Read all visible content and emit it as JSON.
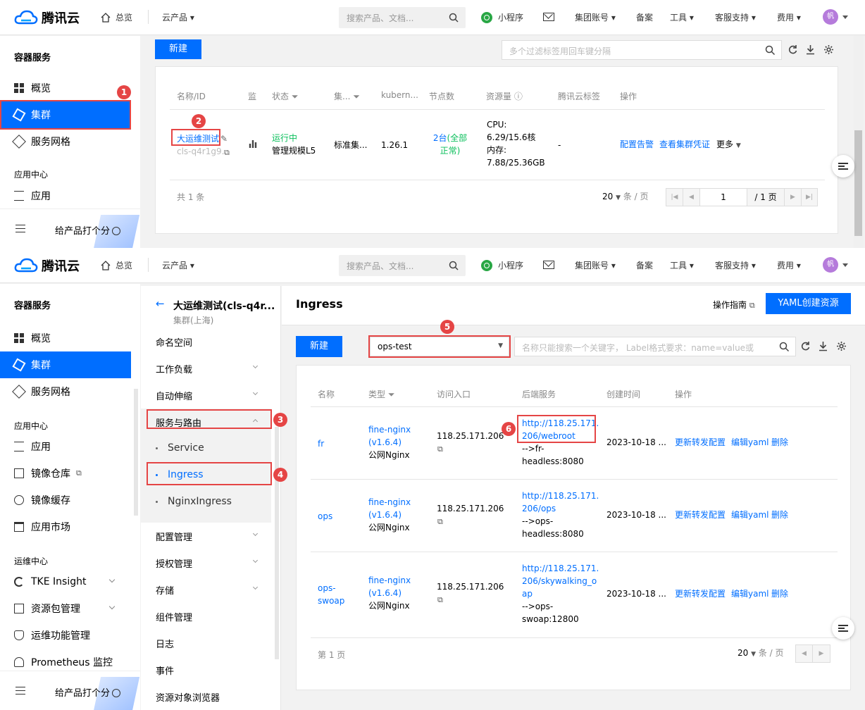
{
  "brand": {
    "name": "腾讯云",
    "accent": "#006eff",
    "highlight": "#e54545"
  },
  "topbar": {
    "home": "总览",
    "products": "云产品 ▾",
    "search_placeholder": "搜索产品、文档...",
    "mini_program": "小程序",
    "group_account": "集团账号 ▾",
    "filing": "备案",
    "tools": "工具 ▾",
    "support": "客服支持 ▾",
    "billing": "费用 ▾",
    "avatar": "帆"
  },
  "sidebar": {
    "title": "容器服务",
    "overview": "概览",
    "cluster": "集群",
    "mesh": "服务网格",
    "app_center": "应用中心",
    "apps": "应用",
    "registry": "镜像仓库",
    "image_cache": "镜像缓存",
    "market": "应用市场",
    "ops_center": "运维中心",
    "tke_insight": "TKE Insight",
    "pkg_mgmt": "资源包管理",
    "ops_feature": "运维功能管理",
    "prometheus": "Prometheus 监控",
    "rate": "给产品打个分"
  },
  "cluster_list": {
    "new_button": "新建",
    "filter_placeholder": "多个过滤标签用回车键分隔",
    "headers": [
      "名称/ID",
      "监",
      "状态",
      "集...",
      "kubern...",
      "节点数",
      "资源量",
      "腾讯云标签",
      "操作"
    ],
    "row": {
      "name": "大运维测试",
      "id": "cls-q4r1g9...",
      "status": "运行中",
      "scale": "管理规模L5",
      "type": "标准集...",
      "version": "1.26.1",
      "nodes": "2台",
      "node_status": "(全部正常)",
      "cpu": "CPU: 6.29/15.6核",
      "mem": "内存: 7.88/25.36GB",
      "tags": "-",
      "op_alarm": "配置告警",
      "op_cred": "查看集群凭证",
      "op_more": "更多"
    },
    "total": "共 1 条",
    "page_size": "20",
    "per_page": "条 / 页",
    "page": "1",
    "pages": "/ 1 页"
  },
  "cluster_detail": {
    "back_title": "大运维测试(cls-q4r...",
    "region": "集群(上海)",
    "menu": {
      "namespace": "命名空间",
      "workload": "工作负载",
      "autoscale": "自动伸缩",
      "service_route": "服务与路由",
      "service": "Service",
      "ingress": "Ingress",
      "nginx_ingress": "NginxIngress",
      "config": "配置管理",
      "auth": "授权管理",
      "storage": "存储",
      "component": "组件管理",
      "log": "日志",
      "event": "事件",
      "browser": "资源对象浏览器"
    }
  },
  "ingress": {
    "title": "Ingress",
    "guide": "操作指南",
    "yaml_button": "YAML创建资源",
    "new_button": "新建",
    "namespace": "ops-test",
    "search_placeholder": "名称只能搜索一个关键字， Label格式要求：name=value或",
    "headers": [
      "名称",
      "类型",
      "访问入口",
      "后端服务",
      "创建时间",
      "操作"
    ],
    "rows": [
      {
        "name": "fr",
        "type1": "fine-nginx",
        "type2": "(v1.6.4)",
        "type3": "公网Nginx",
        "addr": "118.25.171.206",
        "backend_url": "http://118.25.171.206/webroot",
        "backend1": "http://118.25.171.",
        "backend2": "206/webroot",
        "backend3": "-->fr-",
        "backend4": "headless:8080",
        "created": "2023-10-18 ...",
        "op1": "更新转发配置",
        "op2": "编辑yaml",
        "op3": "删除"
      },
      {
        "name": "ops",
        "type1": "fine-nginx",
        "type2": "(v1.6.4)",
        "type3": "公网Nginx",
        "addr": "118.25.171.206",
        "backend1": "http://118.25.171.",
        "backend2": "206/ops",
        "backend3": "-->ops-",
        "backend4": "headless:8080",
        "created": "2023-10-18 ...",
        "op1": "更新转发配置",
        "op2": "编辑yaml",
        "op3": "删除"
      },
      {
        "name1": "ops-",
        "name2": "swoap",
        "type1": "fine-nginx",
        "type2": "(v1.6.4)",
        "type3": "公网Nginx",
        "addr": "118.25.171.206",
        "backend1": "http://118.25.171.",
        "backend2": "206/skywalking_o",
        "backend3": "ap",
        "backend4": "-->ops-",
        "backend5": "swoap:12800",
        "created": "2023-10-18 ...",
        "op1": "更新转发配置",
        "op2": "编辑yaml",
        "op3": "删除"
      }
    ],
    "page": "第 1 页",
    "page_size": "20",
    "per_page": "条 / 页"
  },
  "badges": [
    "1",
    "2",
    "3",
    "4",
    "5",
    "6"
  ]
}
